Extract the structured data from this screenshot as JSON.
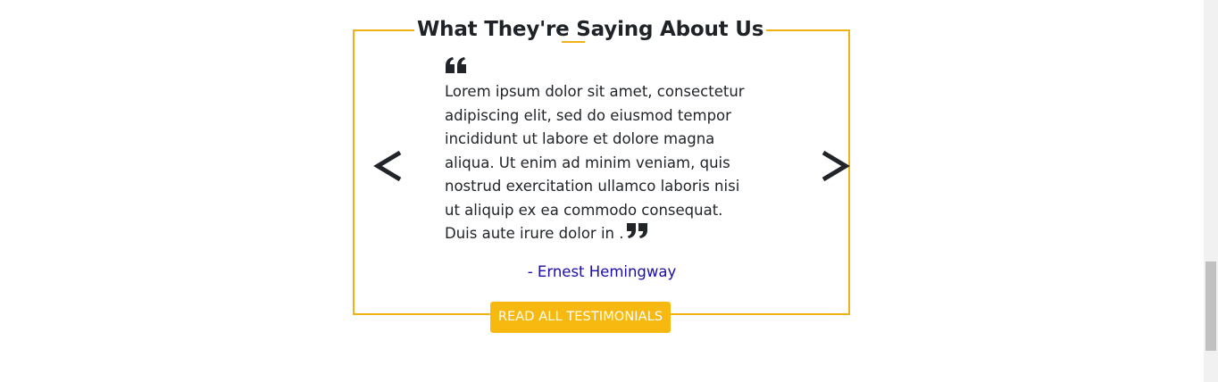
{
  "section": {
    "title": "What They're Saying About Us",
    "accent_color": "#f2b116"
  },
  "carousel": {
    "prev_icon": "chevron-left-icon",
    "next_icon": "chevron-right-icon"
  },
  "testimonial": {
    "open_quote_icon": "quote-open-icon",
    "close_quote_icon": "quote-close-icon",
    "text": "Lorem ipsum dolor sit amet, consectetur adipiscing elit, sed do eiusmod tempor incididunt ut labore et dolore magna aliqua. Ut enim ad minim veniam, quis nostrud exercitation ullamco laboris nisi ut aliquip ex ea commodo consequat. Duis aute irure dolor in .",
    "author": "- Ernest Hemingway",
    "author_color": "#1a0dab"
  },
  "cta": {
    "label": "READ ALL TESTIMONIALS",
    "color": "#f7b90f"
  }
}
